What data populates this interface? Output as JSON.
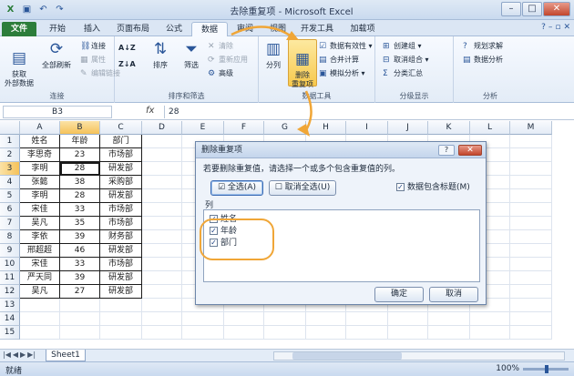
{
  "window": {
    "title": "去除重复项 - Microsoft Excel",
    "minimize": "–",
    "maximize": "□",
    "close": "✕"
  },
  "qa_icons": [
    "excel-icon",
    "save-icon",
    "undo-icon",
    "redo-icon"
  ],
  "tabs": [
    "文件",
    "开始",
    "插入",
    "页面布局",
    "公式",
    "数据",
    "审阅",
    "视图",
    "开发工具",
    "加载项"
  ],
  "ribbon": {
    "get_external": "获取\n外部数据",
    "refresh_all": "全部刷新",
    "connections": "连接",
    "properties": "属性",
    "edit_links": "编辑链接",
    "group_connections": "连接",
    "sort_az": "A↓Z",
    "sort_za": "Z↓A",
    "sort": "排序",
    "filter": "筛选",
    "clear": "清除",
    "reapply": "重新应用",
    "advanced": "高级",
    "group_sort": "排序和筛选",
    "text_to_columns": "分列",
    "remove_duplicates": "删除\n重复项",
    "data_validation": "数据有效性",
    "consolidate": "合并计算",
    "what_if": "模拟分析",
    "group_tools": "数据工具",
    "group": "创建组",
    "ungroup": "取消组合",
    "subtotal": "分类汇总",
    "group_outline": "分级显示",
    "solver": "规划求解",
    "data_analysis": "数据分析",
    "group_analysis": "分析"
  },
  "formula_bar": {
    "name_box": "B3",
    "fx": "fx",
    "value": "28"
  },
  "columns": [
    "A",
    "B",
    "C",
    "D",
    "E",
    "F",
    "G",
    "H",
    "I",
    "J",
    "K",
    "L",
    "M"
  ],
  "rows": [
    "1",
    "2",
    "3",
    "4",
    "5",
    "6",
    "7",
    "8",
    "9",
    "10",
    "11",
    "12",
    "13",
    "14",
    "15"
  ],
  "table": {
    "headers": [
      "姓名",
      "年龄",
      "部门"
    ],
    "data": [
      [
        "李思奇",
        "23",
        "市场部"
      ],
      [
        "李明",
        "28",
        "研发部"
      ],
      [
        "张懿",
        "38",
        "采购部"
      ],
      [
        "李明",
        "28",
        "研发部"
      ],
      [
        "宋佳",
        "33",
        "市场部"
      ],
      [
        "吴凡",
        "35",
        "市场部"
      ],
      [
        "李依",
        "39",
        "财务部"
      ],
      [
        "邢超超",
        "46",
        "研发部"
      ],
      [
        "宋佳",
        "33",
        "市场部"
      ],
      [
        "严天同",
        "39",
        "研发部"
      ],
      [
        "吴凡",
        "27",
        "研发部"
      ]
    ]
  },
  "dialog": {
    "title": "删除重复项",
    "help": "?",
    "close": "✕",
    "prompt": "若要删除重复值，请选择一个或多个包含重复值的列。",
    "select_all": "全选(A)",
    "unselect_all": "取消全选(U)",
    "has_headers": "数据包含标题(M)",
    "list_header": "列",
    "columns": [
      "姓名",
      "年龄",
      "部门"
    ],
    "ok": "确定",
    "cancel": "取消"
  },
  "sheet_tab": "Sheet1",
  "status": {
    "ready": "就绪",
    "zoom": "100%"
  },
  "colors": {
    "accent": "#2c7d3a",
    "highlight": "#f0a637",
    "selection": "#f5c25a"
  }
}
